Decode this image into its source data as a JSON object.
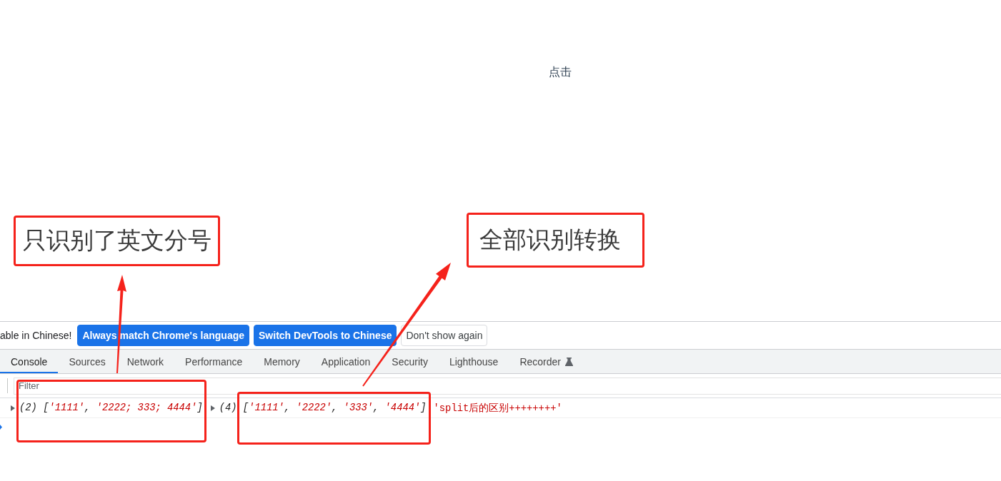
{
  "page": {
    "click_text": "点击"
  },
  "annotations": [
    {
      "kind": "callout",
      "text": "只识别了英文分号"
    },
    {
      "kind": "callout",
      "text": "全部识别转换"
    }
  ],
  "devtools": {
    "infobar": {
      "message": "able in Chinese!",
      "buttons": [
        {
          "kind": "primary",
          "label": "Always match Chrome's language"
        },
        {
          "kind": "primary",
          "label": "Switch DevTools to Chinese"
        },
        {
          "kind": "secondary",
          "label": "Don't show again"
        }
      ]
    },
    "tabs": [
      {
        "label": "Console",
        "selected": true,
        "experimental": false
      },
      {
        "label": "Sources",
        "selected": false,
        "experimental": false
      },
      {
        "label": "Network",
        "selected": false,
        "experimental": false
      },
      {
        "label": "Performance",
        "selected": false,
        "experimental": false
      },
      {
        "label": "Memory",
        "selected": false,
        "experimental": false
      },
      {
        "label": "Application",
        "selected": false,
        "experimental": false
      },
      {
        "label": "Security",
        "selected": false,
        "experimental": false
      },
      {
        "label": "Lighthouse",
        "selected": false,
        "experimental": false
      },
      {
        "label": "Recorder",
        "selected": false,
        "experimental": true
      }
    ],
    "filter": {
      "placeholder": "Filter"
    },
    "console": {
      "messages": [
        {
          "kind": "array",
          "expanded": false,
          "count": "(2)",
          "tokens": [
            {
              "kind": "punct",
              "text": "["
            },
            {
              "kind": "string",
              "text": "'1111'"
            },
            {
              "kind": "punct",
              "text": ", "
            },
            {
              "kind": "string",
              "text": "'2222; 333; 4444'"
            },
            {
              "kind": "punct",
              "text": "]"
            }
          ]
        },
        {
          "kind": "array",
          "expanded": false,
          "count": "(4)",
          "tokens": [
            {
              "kind": "punct",
              "text": "["
            },
            {
              "kind": "string",
              "text": "'1111'"
            },
            {
              "kind": "punct",
              "text": ", "
            },
            {
              "kind": "string",
              "text": "'2222'"
            },
            {
              "kind": "punct",
              "text": ", "
            },
            {
              "kind": "string",
              "text": "'333'"
            },
            {
              "kind": "punct",
              "text": ", "
            },
            {
              "kind": "string",
              "text": "'4444'"
            },
            {
              "kind": "punct",
              "text": "]"
            }
          ]
        },
        {
          "kind": "string",
          "text": "'split后的区别++++++++'"
        }
      ]
    }
  }
}
